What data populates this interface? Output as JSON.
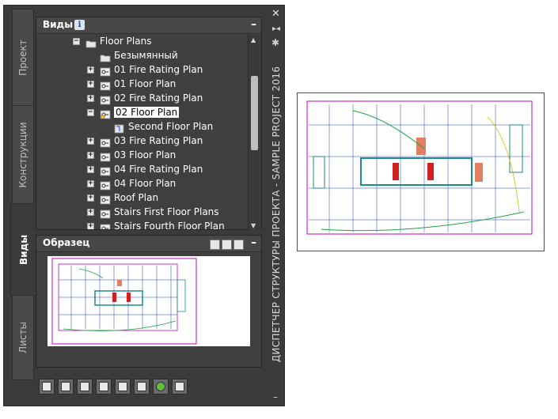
{
  "palette": {
    "title": "ДИСПЕТЧЕР СТРУКТУРЫ ПРОЕКТА - SAMPLE PROJECT 2016",
    "close_icon": "close-icon",
    "pin_icon": "pin-icon",
    "settings_icon": "gear-icon"
  },
  "tabs": [
    {
      "label": "Проект",
      "active": false
    },
    {
      "label": "Конструкции",
      "active": false
    },
    {
      "label": "Виды",
      "active": true
    },
    {
      "label": "Листы",
      "active": false
    }
  ],
  "views_panel": {
    "title": "Виды",
    "info_icon": "i",
    "collapse": "–",
    "tree": [
      {
        "label": "Floor Plans",
        "toggle": "−",
        "icon": "folder-open-icon",
        "level": 0
      },
      {
        "label": "Безымянный",
        "toggle": "",
        "icon": "folder-icon",
        "level": 1
      },
      {
        "label": "01 Fire Rating Plan",
        "toggle": "+",
        "icon": "view-key-icon",
        "level": 1
      },
      {
        "label": "01 Floor Plan",
        "toggle": "+",
        "icon": "view-key-icon",
        "level": 1
      },
      {
        "label": "02 Fire Rating Plan",
        "toggle": "+",
        "icon": "view-key-icon",
        "level": 1
      },
      {
        "label": "02 Floor Plan",
        "toggle": "−",
        "icon": "view-key-lock-icon",
        "level": 1,
        "selected": true
      },
      {
        "label": "Second Floor Plan",
        "toggle": "",
        "icon": "floor-plan-view-icon",
        "level": 2
      },
      {
        "label": "03 Fire Rating Plan",
        "toggle": "+",
        "icon": "view-key-icon",
        "level": 1
      },
      {
        "label": "03 Floor Plan",
        "toggle": "+",
        "icon": "view-key-icon",
        "level": 1
      },
      {
        "label": "04 Fire Rating Plan",
        "toggle": "+",
        "icon": "view-key-icon",
        "level": 1
      },
      {
        "label": "04 Floor Plan",
        "toggle": "+",
        "icon": "view-key-icon",
        "level": 1
      },
      {
        "label": "Roof Plan",
        "toggle": "+",
        "icon": "view-key-icon",
        "level": 1
      },
      {
        "label": "Stairs First Floor Plans",
        "toggle": "+",
        "icon": "view-key-icon",
        "level": 1
      },
      {
        "label": "Stairs Fourth Floor Plan",
        "toggle": "+",
        "icon": "view-key-icon",
        "level": 1
      }
    ]
  },
  "sample_panel": {
    "title": "Образец",
    "collapse": "–"
  },
  "colors": {
    "palette_bg": "#3b3b3b",
    "drawing_magenta": "#c000c0",
    "drawing_teal": "#1a8a8a",
    "drawing_red": "#d02020",
    "drawing_blue": "#2040c0",
    "drawing_green": "#20a040"
  }
}
